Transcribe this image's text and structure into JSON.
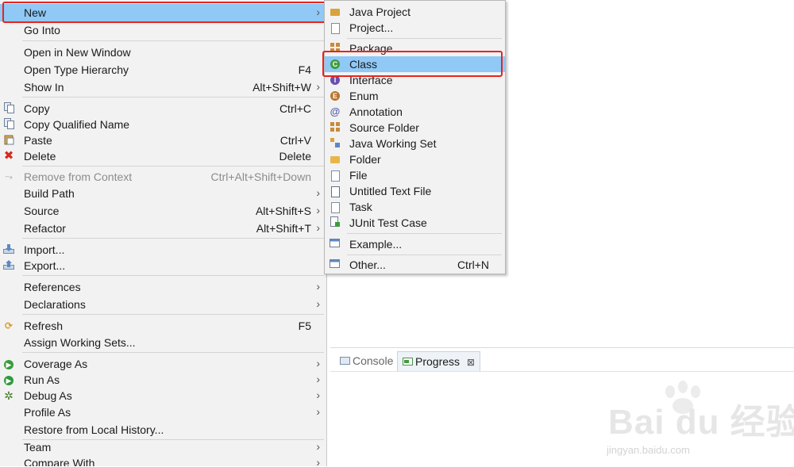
{
  "main_menu": {
    "new": {
      "label": "New"
    },
    "go_into": {
      "label": "Go Into"
    },
    "open_new_window": {
      "label": "Open in New Window"
    },
    "open_type_hierarchy": {
      "label": "Open Type Hierarchy",
      "shortcut": "F4"
    },
    "show_in": {
      "label": "Show In",
      "shortcut": "Alt+Shift+W"
    },
    "copy": {
      "label": "Copy",
      "shortcut": "Ctrl+C"
    },
    "copy_qualified": {
      "label": "Copy Qualified Name"
    },
    "paste": {
      "label": "Paste",
      "shortcut": "Ctrl+V"
    },
    "delete": {
      "label": "Delete",
      "shortcut": "Delete"
    },
    "remove_context": {
      "label": "Remove from Context",
      "shortcut": "Ctrl+Alt+Shift+Down"
    },
    "build_path": {
      "label": "Build Path"
    },
    "source": {
      "label": "Source",
      "shortcut": "Alt+Shift+S"
    },
    "refactor": {
      "label": "Refactor",
      "shortcut": "Alt+Shift+T"
    },
    "import": {
      "label": "Import..."
    },
    "export": {
      "label": "Export..."
    },
    "references": {
      "label": "References"
    },
    "declarations": {
      "label": "Declarations"
    },
    "refresh": {
      "label": "Refresh",
      "shortcut": "F5"
    },
    "assign_working_sets": {
      "label": "Assign Working Sets..."
    },
    "coverage_as": {
      "label": "Coverage As"
    },
    "run_as": {
      "label": "Run As"
    },
    "debug_as": {
      "label": "Debug As"
    },
    "profile_as": {
      "label": "Profile As"
    },
    "restore_history": {
      "label": "Restore from Local History..."
    },
    "team": {
      "label": "Team"
    },
    "compare_with": {
      "label": "Compare With"
    }
  },
  "submenu": {
    "java_project": {
      "label": "Java Project"
    },
    "project": {
      "label": "Project..."
    },
    "package": {
      "label": "Package"
    },
    "class": {
      "label": "Class"
    },
    "interface": {
      "label": "Interface"
    },
    "enum": {
      "label": "Enum"
    },
    "annotation": {
      "label": "Annotation"
    },
    "source_folder": {
      "label": "Source Folder"
    },
    "java_working_set": {
      "label": "Java Working Set"
    },
    "folder": {
      "label": "Folder"
    },
    "file": {
      "label": "File"
    },
    "untitled_text_file": {
      "label": "Untitled Text File"
    },
    "task": {
      "label": "Task"
    },
    "junit_test_case": {
      "label": "JUnit Test Case"
    },
    "example": {
      "label": "Example..."
    },
    "other": {
      "label": "Other...",
      "shortcut": "Ctrl+N"
    }
  },
  "panel": {
    "tabs": [
      {
        "label": "Console"
      },
      {
        "label": "Progress",
        "close": "⊠"
      }
    ]
  },
  "watermark": {
    "main": "Bai du 经验",
    "url": "jingyan.baidu.com"
  },
  "colors": {
    "selection": "#90c8f6",
    "highlight_box": "#e8231f",
    "menu_bg": "#f2f2f2"
  }
}
